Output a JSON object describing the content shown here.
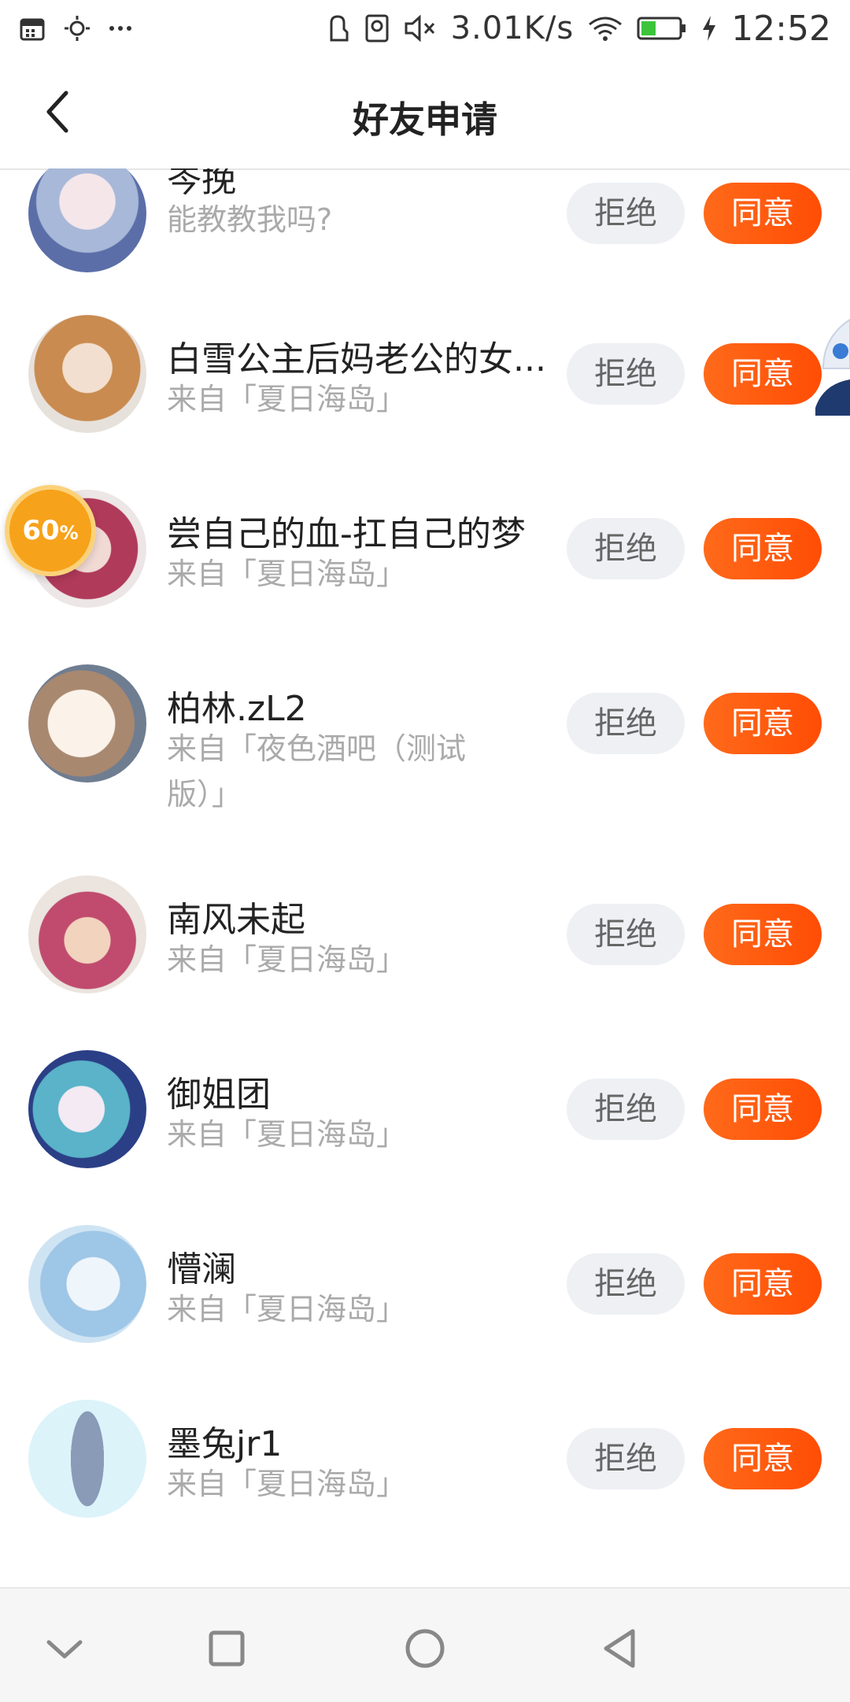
{
  "status_bar": {
    "left_icons": [
      "calendar-icon",
      "brightness-icon",
      "more-dots-icon"
    ],
    "right_icons": [
      "nfc-icon",
      "badge-icon",
      "mute-icon"
    ],
    "network_speed": "3.01K/s",
    "time": "12:52"
  },
  "header": {
    "title": "好友申请"
  },
  "buttons": {
    "reject": "拒绝",
    "accept": "同意"
  },
  "requests": [
    {
      "name": "岑挽",
      "sub": "能教教我吗?"
    },
    {
      "name": "白雪公主后妈老公的女...",
      "sub": "来自「夏日海岛」"
    },
    {
      "name": "尝自己的血-扛自己的梦",
      "sub": "来自「夏日海岛」"
    },
    {
      "name": "柏林.zL2",
      "sub": "来自「夜色酒吧（测试版）」"
    },
    {
      "name": "南风未起",
      "sub": "来自「夏日海岛」"
    },
    {
      "name": "御姐团",
      "sub": "来自「夏日海岛」"
    },
    {
      "name": "懵澜",
      "sub": "来自「夏日海岛」"
    },
    {
      "name": "墨兔jr1",
      "sub": "来自「夏日海岛」"
    }
  ],
  "floating_badge": {
    "value": "60",
    "unit": "%"
  },
  "nav_bar": [
    "chevron-down-icon",
    "square-icon",
    "circle-icon",
    "triangle-back-icon"
  ],
  "colors": {
    "accent": "#ff5a0f",
    "reject_bg": "#eef0f4",
    "secondary_text": "#aaaaaa"
  }
}
